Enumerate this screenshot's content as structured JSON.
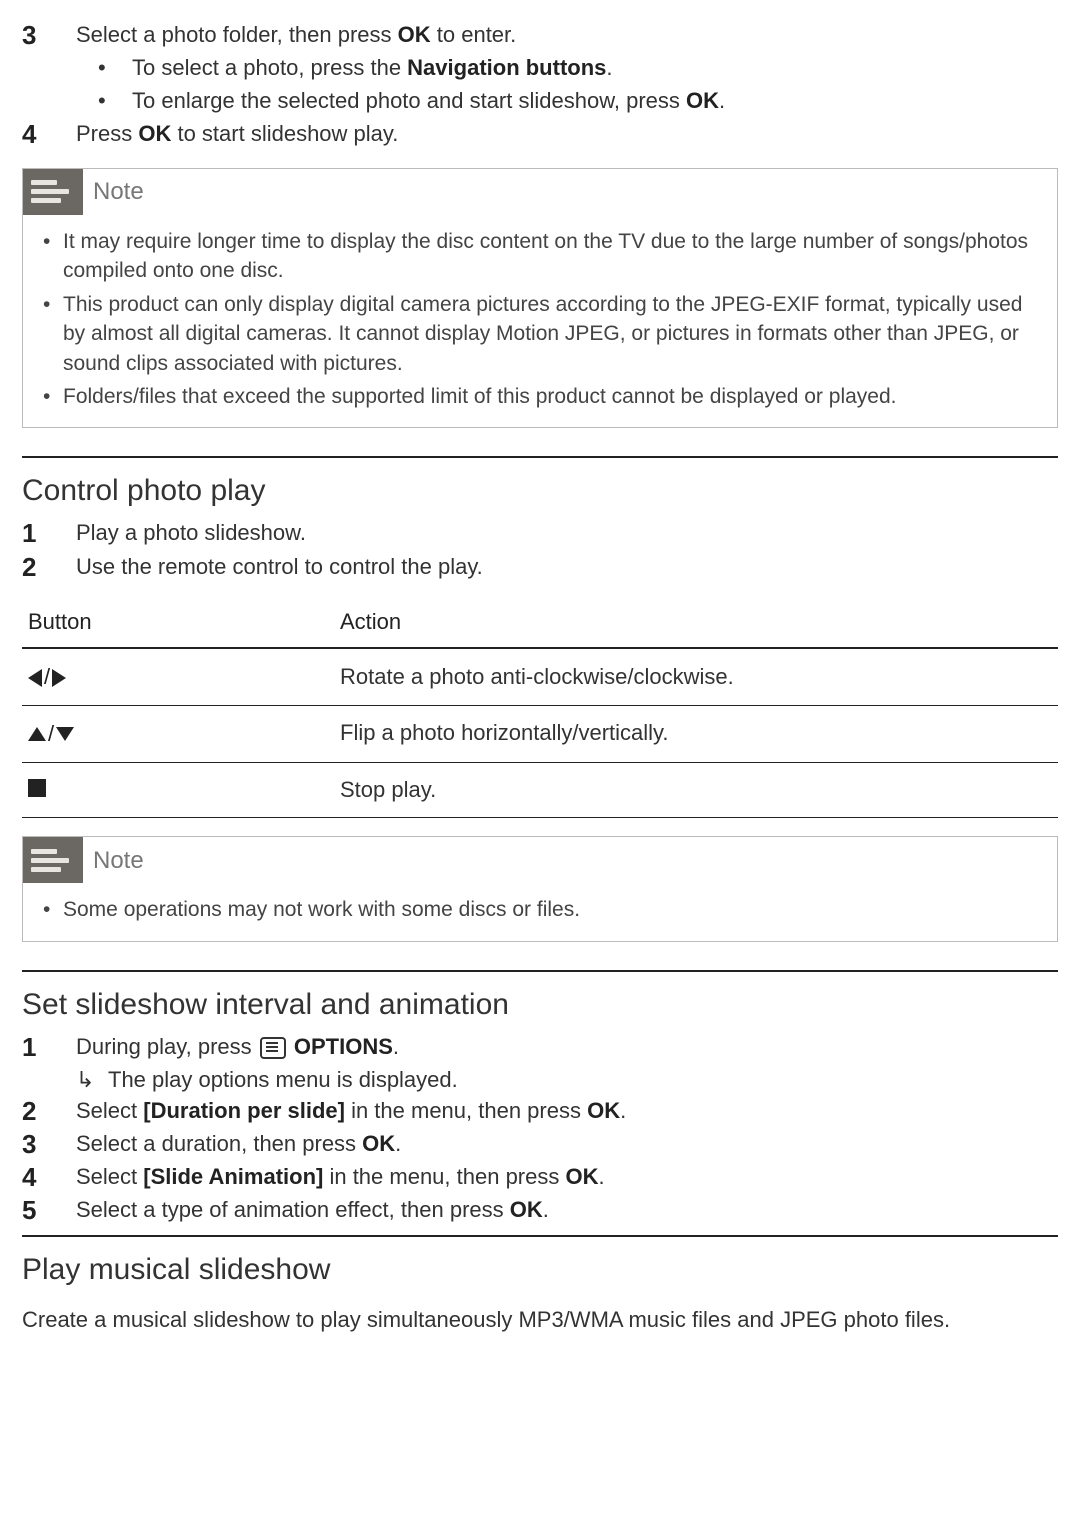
{
  "steps_a": {
    "3": {
      "text_before": "Select a photo folder, then press ",
      "bold1": "OK",
      "text_after": " to enter.",
      "sub1_before": "To select a photo, press the ",
      "sub1_bold": "Navigation buttons",
      "sub1_after": ".",
      "sub2_before": "To enlarge the selected photo and start slideshow, press ",
      "sub2_bold": "OK",
      "sub2_after": "."
    },
    "4": {
      "text_before": "Press ",
      "bold1": "OK",
      "text_after": " to start slideshow play."
    }
  },
  "note1": {
    "label": "Note",
    "items": [
      "It may require longer time to display the disc content on the TV due to the large number of songs/photos compiled onto one disc.",
      "This product can only display digital camera pictures according to the JPEG-EXIF format, typically used by almost all digital cameras. It cannot display Motion JPEG, or pictures in formats other than JPEG, or sound clips associated with pictures.",
      "Folders/files that exceed the supported limit of this product cannot be displayed or played."
    ]
  },
  "section_control": {
    "heading": "Control photo play",
    "step1": "Play a photo slideshow.",
    "step2": "Use the remote control to control the play."
  },
  "table": {
    "h_button": "Button",
    "h_action": "Action",
    "rows": [
      {
        "action": "Rotate a photo anti-clockwise/clockwise."
      },
      {
        "action": "Flip a photo horizontally/vertically."
      },
      {
        "action": "Stop play."
      }
    ]
  },
  "note2": {
    "label": "Note",
    "items": [
      "Some operations may not work with some discs or files."
    ]
  },
  "section_slideshow": {
    "heading": "Set slideshow interval and animation",
    "step1_before": "During play, press ",
    "step1_bold": " OPTIONS",
    "step1_after": ".",
    "step1_result": "The play options menu is displayed.",
    "step2_before": "Select ",
    "step2_bold": "[Duration per slide]",
    "step2_mid": " in the menu, then press ",
    "step2_bold2": "OK",
    "step2_after": ".",
    "step3_before": "Select a duration, then press ",
    "step3_bold": "OK",
    "step3_after": ".",
    "step4_before": "Select ",
    "step4_bold": "[Slide Animation]",
    "step4_mid": " in the menu, then press ",
    "step4_bold2": "OK",
    "step4_after": ".",
    "step5_before": "Select a type of animation effect, then press ",
    "step5_bold": "OK",
    "step5_after": "."
  },
  "section_musical": {
    "heading": "Play musical slideshow",
    "para": "Create a musical slideshow to play simultaneously MP3/WMA music files and JPEG photo files."
  }
}
